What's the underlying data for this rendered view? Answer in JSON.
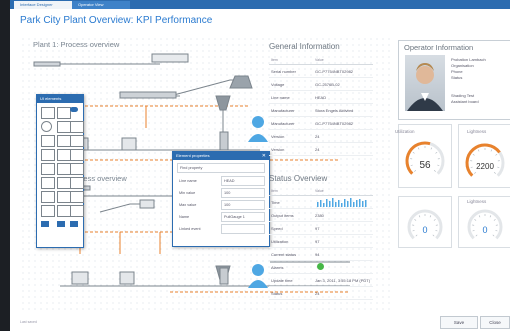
{
  "tabs": [
    {
      "label": "Interface Designer"
    },
    {
      "label": "Operator View"
    }
  ],
  "title": "Park City Plant Overview: KPI Performance",
  "sections": {
    "plant1": "Plant 1: Process overview",
    "plant2": "Process overview",
    "general": "General Information",
    "operator": "Operator Information",
    "status": "Status Overview"
  },
  "general_info": {
    "headers": [
      "Item",
      "Value"
    ],
    "rows": [
      {
        "k": "Serial number",
        "v": "GC-P7754NBT02982"
      },
      {
        "k": "Voltage",
        "v": "GC-2576B-02"
      },
      {
        "k": "Line name",
        "v": "HEAD"
      },
      {
        "k": "Manufacturer",
        "v": "Stora Engels Aktivbrd"
      },
      {
        "k": "Manufacturer",
        "v": "GC-P7754NBT02982"
      },
      {
        "k": "Version",
        "v": "24"
      },
      {
        "k": "Version",
        "v": "24"
      }
    ]
  },
  "operator_info": {
    "lines": [
      "Probation Lambach",
      "Organisation",
      "Phone",
      "Status",
      "",
      "Shading Test",
      "Assistant board"
    ]
  },
  "status_overview": {
    "headers": [
      "Item",
      "Value"
    ],
    "rows": [
      {
        "k": "Time",
        "v": ""
      },
      {
        "k": "Output items",
        "v": "2380"
      },
      {
        "k": "Speed",
        "v": "97"
      },
      {
        "k": "Utilization",
        "v": "97"
      },
      {
        "k": "Current status",
        "v": "94"
      },
      {
        "k": "Alarms",
        "v": ""
      },
      {
        "k": "Update time",
        "v": "Jan 3, 2011, 3:55:18 PM (PDT)"
      },
      {
        "k": "Status",
        "v": "24"
      }
    ]
  },
  "gauges": [
    {
      "label": "Utilization",
      "value": "56",
      "fraction": 0.56
    },
    {
      "label": "Lightness",
      "value": "2200",
      "fraction": 0.7
    },
    {
      "label": "",
      "value": "0",
      "fraction": 0.0
    },
    {
      "label": "Lightness",
      "value": "0",
      "fraction": 0.0
    }
  ],
  "toolbox": {
    "title": "UI elements"
  },
  "properties": {
    "title": "Element properties",
    "search": "Find property",
    "rows": [
      {
        "k": "Line name",
        "v": "HEAD"
      },
      {
        "k": "Min value",
        "v": "100"
      },
      {
        "k": "Max value",
        "v": "100"
      },
      {
        "k": "Name",
        "v": "PullGauge 1"
      },
      {
        "k": "Linked event",
        "v": ""
      }
    ]
  },
  "footer": {
    "text": "Last saved"
  },
  "buttons": {
    "save": "Save",
    "close": "Close"
  },
  "colors": {
    "accent": "#2b7bd0",
    "gauge": "#e8822d",
    "gauge_blue": "#2b7bd0",
    "ok": "#46b646"
  }
}
